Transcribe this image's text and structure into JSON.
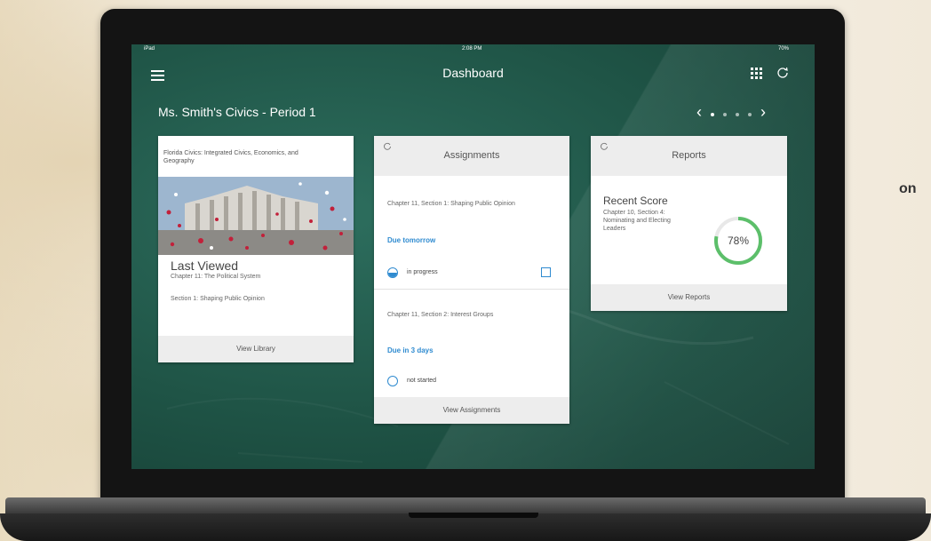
{
  "page": {
    "side_text": "on"
  },
  "app": {
    "status": {
      "device": "iPad",
      "time": "2:08 PM",
      "battery": "70%"
    },
    "title": "Dashboard",
    "icons": {
      "menu": "menu-icon",
      "grid": "grid-icon",
      "refresh": "refresh-icon"
    },
    "course_title": "Ms. Smith's Civics - Period 1",
    "pager": {
      "prev": "‹",
      "next": "›",
      "page_count": 4,
      "current_page": 1
    }
  },
  "library_card": {
    "book_title": "Florida Civics: Integrated Civics, Economics, and Geography",
    "last_viewed_label": "Last Viewed",
    "chapter": "Chapter 11: The Political System",
    "section": "Section 1: Shaping Public Opinion",
    "footer": "View Library"
  },
  "assignments_card": {
    "title": "Assignments",
    "items": [
      {
        "name": "Chapter 11, Section 1: Shaping Public Opinion",
        "due": "Due tomorrow",
        "status": "in progress"
      },
      {
        "name": "Chapter 11, Section 2:  Interest Groups",
        "due": "Due in 3 days",
        "status": "not started"
      }
    ],
    "footer": "View Assignments"
  },
  "reports_card": {
    "title": "Reports",
    "recent_score_label": "Recent Score",
    "chapter": "Chapter 10, Section 4: Nominating and Electing Leaders",
    "score": "78%",
    "score_fraction": 0.78,
    "footer": "View Reports"
  },
  "colors": {
    "chalkboard": "#1f5446",
    "accent": "#2f8bd0",
    "score_ring": "#5cbf6a"
  }
}
